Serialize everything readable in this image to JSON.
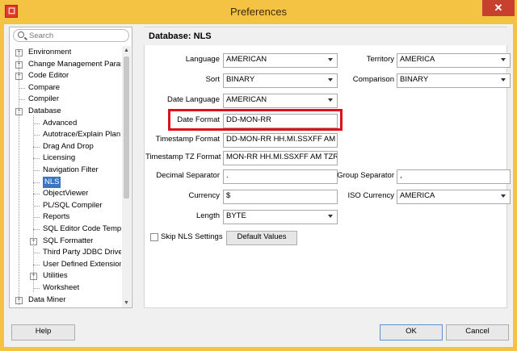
{
  "window": {
    "title": "Preferences",
    "close_glyph": "✕",
    "app_icon": "oracle-icon"
  },
  "search": {
    "placeholder": "Search"
  },
  "tree": {
    "items": [
      {
        "label": "Environment",
        "exp": "+"
      },
      {
        "label": "Change Management Parar",
        "exp": "+"
      },
      {
        "label": "Code Editor",
        "exp": "+"
      },
      {
        "label": "Compare",
        "exp": ""
      },
      {
        "label": "Compiler",
        "exp": ""
      },
      {
        "label": "Database",
        "exp": "−"
      },
      {
        "label": "Advanced",
        "exp": ""
      },
      {
        "label": "Autotrace/Explain Plan",
        "exp": ""
      },
      {
        "label": "Drag And Drop",
        "exp": ""
      },
      {
        "label": "Licensing",
        "exp": ""
      },
      {
        "label": "Navigation Filter",
        "exp": ""
      },
      {
        "label": "NLS",
        "exp": ""
      },
      {
        "label": "ObjectViewer",
        "exp": ""
      },
      {
        "label": "PL/SQL Compiler",
        "exp": ""
      },
      {
        "label": "Reports",
        "exp": ""
      },
      {
        "label": "SQL Editor Code Templa",
        "exp": ""
      },
      {
        "label": "SQL Formatter",
        "exp": "+"
      },
      {
        "label": "Third Party JDBC Driver",
        "exp": ""
      },
      {
        "label": "User Defined Extension",
        "exp": ""
      },
      {
        "label": "Utilities",
        "exp": "+"
      },
      {
        "label": "Worksheet",
        "exp": ""
      },
      {
        "label": "Data Miner",
        "exp": "+"
      }
    ]
  },
  "panel": {
    "title": "Database: NLS",
    "language": {
      "label": "Language",
      "value": "AMERICAN"
    },
    "territory": {
      "label": "Territory",
      "value": "AMERICA"
    },
    "sort": {
      "label": "Sort",
      "value": "BINARY"
    },
    "comparison": {
      "label": "Comparison",
      "value": "BINARY"
    },
    "date_language": {
      "label": "Date Language",
      "value": "AMERICAN"
    },
    "date_format": {
      "label": "Date Format",
      "value": "DD-MON-RR"
    },
    "timestamp_format": {
      "label": "Timestamp Format",
      "value": "DD-MON-RR HH.MI.SSXFF AM"
    },
    "timestamp_tz_format": {
      "label": "Timestamp TZ Format",
      "value": "MON-RR HH.MI.SSXFF AM TZR"
    },
    "decimal_separator": {
      "label": "Decimal Separator",
      "value": "."
    },
    "group_separator": {
      "label": "Group Separator",
      "value": ","
    },
    "currency": {
      "label": "Currency",
      "value": "$"
    },
    "iso_currency": {
      "label": "ISO Currency",
      "value": "AMERICA"
    },
    "length": {
      "label": "Length",
      "value": "BYTE"
    },
    "skip_nls": {
      "label": "Skip NLS Settings",
      "checked": false
    },
    "default_values_label": "Default Values"
  },
  "footer": {
    "help_label": "Help",
    "ok_label": "OK",
    "cancel_label": "Cancel"
  },
  "colors": {
    "titlebar": "#f4c343",
    "selection": "#3b74c4",
    "highlight": "#e0101a"
  }
}
